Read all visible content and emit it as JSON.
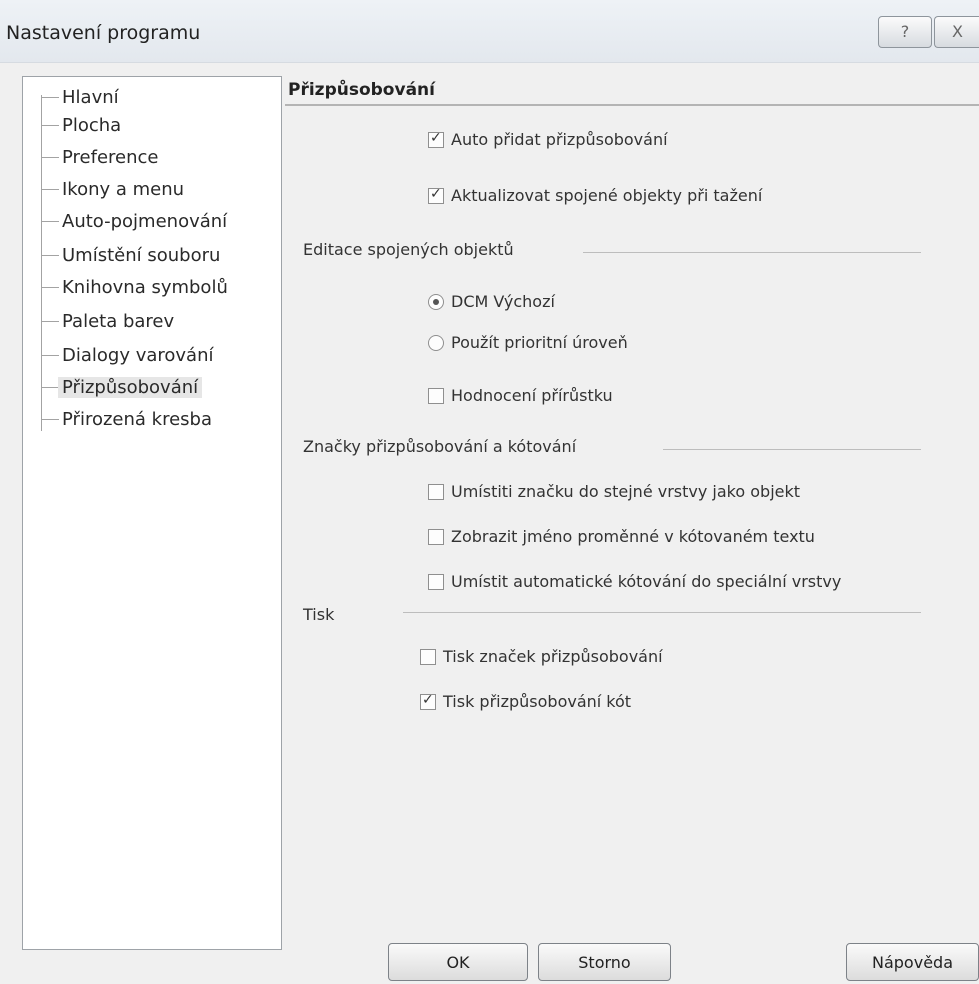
{
  "window": {
    "title": "Nastavení programu",
    "help_button": "?",
    "close_button": "X"
  },
  "tree": {
    "items": [
      {
        "label": "Hlavní"
      },
      {
        "label": "Plocha"
      },
      {
        "label": "Preference"
      },
      {
        "label": "Ikony a menu"
      },
      {
        "label": "Auto-pojmenování"
      },
      {
        "label": "Umístění souboru"
      },
      {
        "label": "Knihovna symbolů"
      },
      {
        "label": "Paleta barev"
      },
      {
        "label": "Dialogy varování"
      },
      {
        "label": "Přizpůsobování",
        "selected": true
      },
      {
        "label": "Přirozená kresba"
      }
    ]
  },
  "panel": {
    "title": "Přizpůsobování",
    "auto_add": {
      "label": "Auto přidat přizpůsobování",
      "checked": true
    },
    "update_joined": {
      "label": "Aktualizovat spojené objekty při tažení",
      "checked": true
    },
    "editing_group": {
      "label": "Editace spojených objektů",
      "dcm_default": {
        "label": "DCM Výchozí",
        "selected": true
      },
      "use_priority": {
        "label": "Použít prioritní úroveň",
        "selected": false
      },
      "increment_eval": {
        "label": "Hodnocení přírůstku",
        "checked": false
      }
    },
    "marks_group": {
      "label": "Značky přizpůsobování a kótování",
      "same_layer": {
        "label": "Umístiti značku do stejné vrstvy jako objekt",
        "checked": false
      },
      "show_var_name": {
        "label": "Zobrazit jméno proměnné v kótovaném textu",
        "checked": false
      },
      "special_layer": {
        "label": "Umístit automatické kótování do speciální vrstvy",
        "checked": false
      }
    },
    "print_group": {
      "label": "Tisk",
      "print_marks": {
        "label": "Tisk značek přizpůsobování",
        "checked": false
      },
      "print_dims": {
        "label": "Tisk přizpůsobování kót",
        "checked": true
      }
    }
  },
  "buttons": {
    "ok": "OK",
    "cancel": "Storno",
    "help": "Nápověda"
  }
}
